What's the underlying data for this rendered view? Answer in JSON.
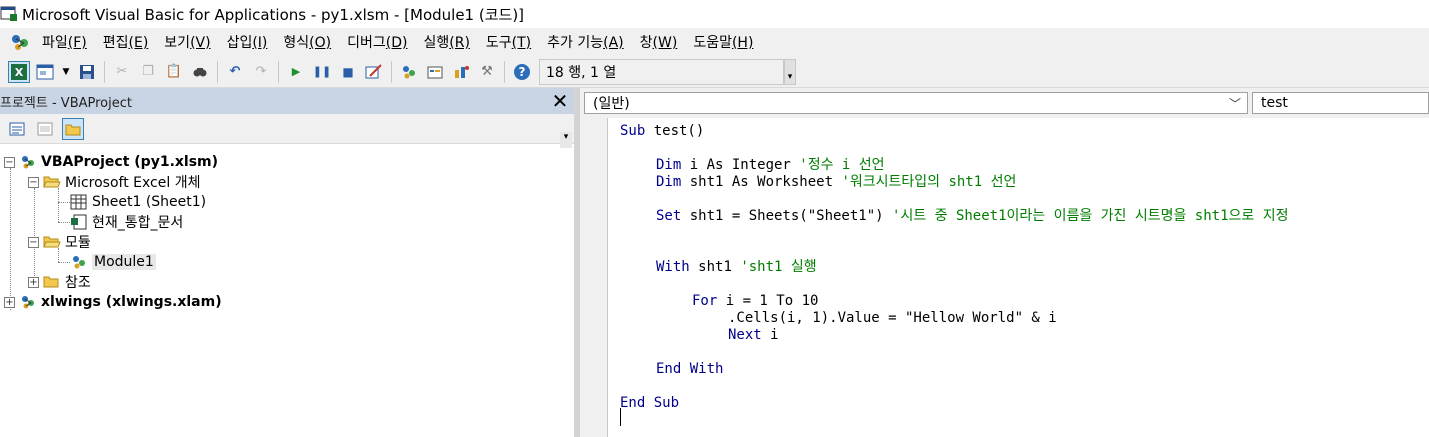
{
  "window": {
    "title": "Microsoft Visual Basic for Applications - py1.xlsm - [Module1 (코드)]"
  },
  "menu": {
    "items": [
      {
        "label": "파일",
        "key": "(F)"
      },
      {
        "label": "편집",
        "key": "(E)"
      },
      {
        "label": "보기",
        "key": "(V)"
      },
      {
        "label": "삽입",
        "key": "(I)"
      },
      {
        "label": "형식",
        "key": "(O)"
      },
      {
        "label": "디버그",
        "key": "(D)"
      },
      {
        "label": "실행",
        "key": "(R)"
      },
      {
        "label": "도구",
        "key": "(T)"
      },
      {
        "label": "추가 기능",
        "key": "(A)"
      },
      {
        "label": "창",
        "key": "(W)"
      },
      {
        "label": "도움말",
        "key": "(H)"
      }
    ]
  },
  "toolbar": {
    "position": "18 행, 1 열",
    "icons": [
      "view-excel-icon",
      "insert-userform-icon",
      "dropdown-icon",
      "save-icon",
      "cut-icon",
      "copy-icon",
      "paste-icon",
      "find-icon",
      "undo-icon",
      "redo-icon",
      "run-icon",
      "break-icon",
      "reset-icon",
      "design-mode-icon",
      "project-explorer-icon",
      "properties-icon",
      "object-browser-icon",
      "toolbox-icon",
      "help-icon"
    ]
  },
  "project": {
    "title": "프로젝트 - VBAProject",
    "tree": [
      {
        "label": "VBAProject (py1.xlsm)",
        "bold": true
      },
      {
        "label": "Microsoft Excel 개체"
      },
      {
        "label": "Sheet1 (Sheet1)"
      },
      {
        "label": "현재_통합_문서"
      },
      {
        "label": "모듈"
      },
      {
        "label": "Module1"
      },
      {
        "label": "참조"
      },
      {
        "label": "xlwings (xlwings.xlam)",
        "bold": true
      }
    ]
  },
  "code": {
    "object_combo": "(일반)",
    "proc_combo": "test",
    "lines": [
      {
        "kw": "Sub ",
        "tx": "test()",
        "cm": ""
      },
      {
        "kw": "Dim ",
        "tx": "i As Integer ",
        "cm": "'정수 i 선언"
      },
      {
        "kw": "Dim ",
        "tx": "sht1 As Worksheet ",
        "cm": "'워크시트타입의 sht1 선언"
      },
      {
        "kw": "Set ",
        "tx": "sht1 = Sheets(\"Sheet1\") ",
        "cm": "'시트 중 Sheet1이라는 이름을 가진 시트명을 sht1으로 지정"
      },
      {
        "kw": "With ",
        "tx": "sht1 ",
        "cm": "'sht1 실행"
      },
      {
        "kw": "For ",
        "tx": "i = 1 To 10",
        "cm": ""
      },
      {
        "kw": "",
        "tx": ".Cells(i, 1).Value = \"Hellow World\" & i",
        "cm": ""
      },
      {
        "kw": "Next ",
        "tx": "i",
        "cm": ""
      },
      {
        "kw": "End With",
        "tx": "",
        "cm": ""
      },
      {
        "kw": "End Sub",
        "tx": "",
        "cm": ""
      }
    ]
  },
  "colors": {
    "keyword": "#00008b",
    "comment": "#007d00",
    "project_header": "#c8d4e4"
  }
}
